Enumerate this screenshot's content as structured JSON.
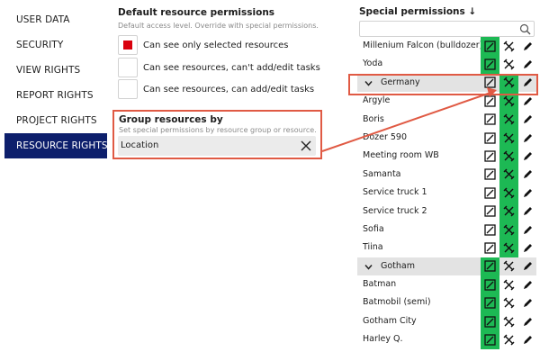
{
  "sidebar": {
    "items": [
      {
        "label": "USER DATA",
        "active": false
      },
      {
        "label": "SECURITY",
        "active": false
      },
      {
        "label": "VIEW RIGHTS",
        "active": false
      },
      {
        "label": "REPORT RIGHTS",
        "active": false
      },
      {
        "label": "PROJECT RIGHTS",
        "active": false
      },
      {
        "label": "RESOURCE RIGHTS",
        "active": true
      }
    ]
  },
  "default_permissions": {
    "title": "Default resource permissions",
    "description": "Default access level. Override with special permissions.",
    "options": [
      {
        "label": "Can see only selected resources",
        "selected": true
      },
      {
        "label": "Can see resources, can't add/edit tasks",
        "selected": false
      },
      {
        "label": "Can see resources, can add/edit tasks",
        "selected": false
      }
    ]
  },
  "group_resources": {
    "title": "Group resources by",
    "description": "Set special permissions by resource group or resource.",
    "value": "Location"
  },
  "special_permissions": {
    "title": "Special permissions ↓",
    "search_placeholder": "",
    "rows": [
      {
        "name": "Millenium Falcon (bulldozer)",
        "group": false,
        "state": "col1"
      },
      {
        "name": "Yoda",
        "group": false,
        "state": "col1"
      },
      {
        "name": "Germany",
        "group": true,
        "state": "col2"
      },
      {
        "name": "Argyle",
        "group": false,
        "state": "col2"
      },
      {
        "name": "Boris",
        "group": false,
        "state": "col2"
      },
      {
        "name": "Dozer 590",
        "group": false,
        "state": "col2"
      },
      {
        "name": "Meeting room WB",
        "group": false,
        "state": "col2"
      },
      {
        "name": "Samanta",
        "group": false,
        "state": "col2"
      },
      {
        "name": "Service truck 1",
        "group": false,
        "state": "col2"
      },
      {
        "name": "Service truck 2",
        "group": false,
        "state": "col2"
      },
      {
        "name": "Sofia",
        "group": false,
        "state": "col2"
      },
      {
        "name": "Tiina",
        "group": false,
        "state": "col2"
      },
      {
        "name": "Gotham",
        "group": true,
        "state": "col1"
      },
      {
        "name": "Batman",
        "group": false,
        "state": "col1"
      },
      {
        "name": "Batmobil (semi)",
        "group": false,
        "state": "col1"
      },
      {
        "name": "Gotham City",
        "group": false,
        "state": "col1"
      },
      {
        "name": "Harley Q.",
        "group": false,
        "state": "col1"
      }
    ]
  },
  "colors": {
    "sidebar_active_bg": "#0d1f6c",
    "selected_checkbox": "#d9000d",
    "permission_on": "#1db954",
    "highlight": "#e05a44",
    "group_row_bg": "#e3e3e3"
  },
  "icons": {
    "col1": "edit-square-icon",
    "col2": "tools-icon",
    "col3": "pencil-icon"
  }
}
